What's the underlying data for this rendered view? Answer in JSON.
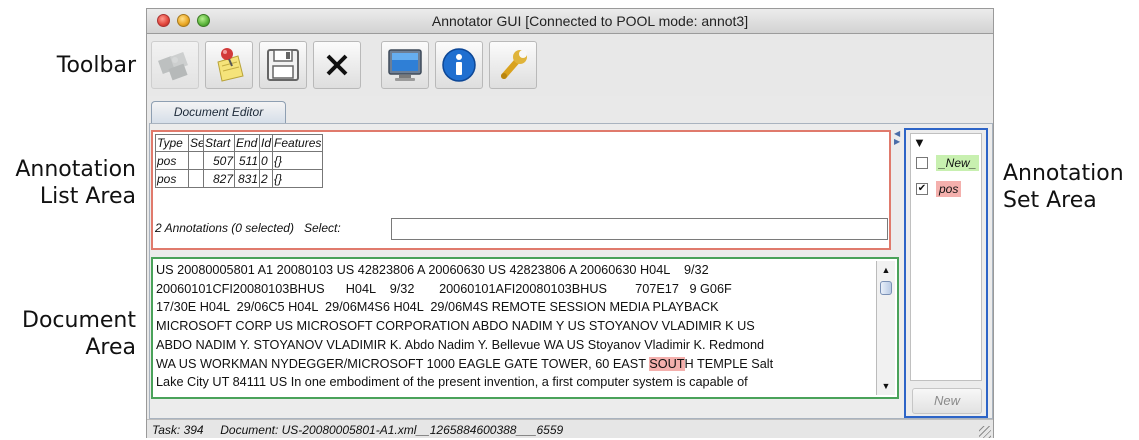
{
  "callouts": {
    "toolbar": "Toolbar",
    "annotation_list_area": "Annotation\nList Area",
    "document_area": "Document\nArea",
    "annotation_set_area": "Annotation\nSet Area"
  },
  "window": {
    "title": "Annotator GUI [Connected to POOL mode: annot3]"
  },
  "toolbar": {
    "buttons": [
      {
        "icon": "puzzle-icon",
        "state": "disabled"
      },
      {
        "icon": "sticky-note-pin-icon",
        "state": "enabled"
      },
      {
        "icon": "floppy-disk-save-icon",
        "state": "enabled"
      },
      {
        "icon": "close-x-icon",
        "state": "enabled"
      },
      {
        "icon": "monitor-icon",
        "state": "enabled"
      },
      {
        "icon": "info-icon",
        "state": "enabled"
      },
      {
        "icon": "wrench-icon",
        "state": "enabled"
      }
    ]
  },
  "tab": {
    "label": "Document Editor"
  },
  "annotation_list": {
    "columns": [
      "Type",
      "Set",
      "Start",
      "End",
      "Id",
      "Features"
    ],
    "rows": [
      {
        "type": "pos",
        "set": "",
        "start": "507",
        "end": "511",
        "id": "0",
        "features": "{}"
      },
      {
        "type": "pos",
        "set": "",
        "start": "827",
        "end": "831",
        "id": "2",
        "features": "{}"
      }
    ],
    "status": "2 Annotations (0 selected)",
    "select_label": "Select:",
    "select_value": ""
  },
  "document": {
    "text_before": "US 20080005801 A1 20080103 US 42823806 A 20060630 US 42823806 A 20060630 H04L    9/32\n20060101CFI20080103BHUS      H04L    9/32       20060101AFI20080103BHUS        707E17   9 G06F\n17/30E H04L  29/06C5 H04L  29/06M4S6 H04L  29/06M4S REMOTE SESSION MEDIA PLAYBACK\nMICROSOFT CORP US MICROSOFT CORPORATION ABDO NADIM Y US STOYANOV VLADIMIR K US\nABDO NADIM Y. STOYANOV VLADIMIR K. Abdo Nadim Y. Bellevue WA US Stoyanov Vladimir K. Redmond\nWA US WORKMAN NYDEGGER/MICROSOFT 1000 EAGLE GATE TOWER, 60 EAST ",
    "highlight": "SOUT",
    "text_after": "H TEMPLE Salt\nLake City UT 84111 US In one embodiment of the present invention, a first computer system is capable of"
  },
  "annotation_sets": {
    "items": [
      {
        "label": "_New_",
        "checked": false,
        "color": "#c8f0b0"
      },
      {
        "label": "pos",
        "checked": true,
        "color": "#f4b0ad"
      }
    ],
    "check_mark": "✔",
    "new_button_label": "New"
  },
  "status_bar": {
    "task": "Task: 394",
    "document": "Document: US-20080005801-A1.xml__1265884600388___6559"
  }
}
